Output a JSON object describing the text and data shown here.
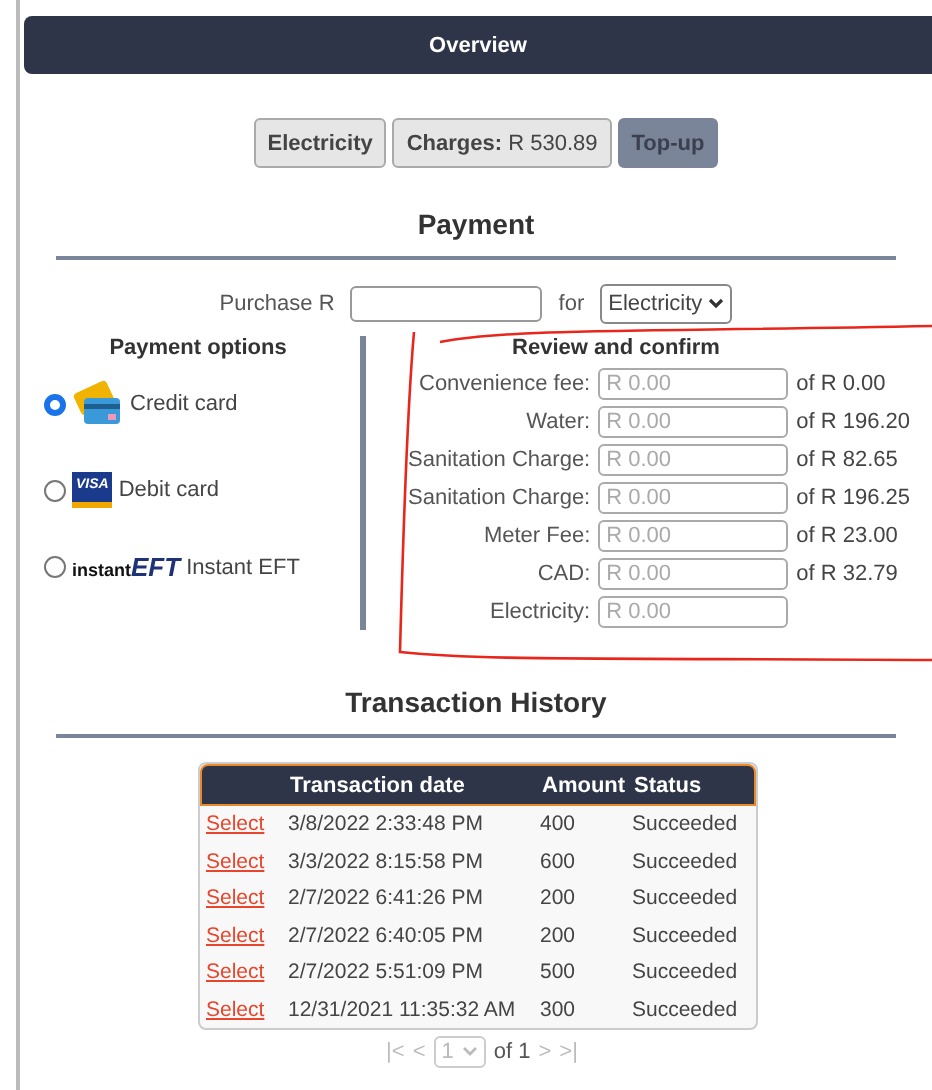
{
  "header": {
    "title": "Overview"
  },
  "toolbar": [
    {
      "kind": "plain",
      "label": "Electricity",
      "selected": false
    },
    {
      "kind": "value",
      "label": "Charges:",
      "value": "R 530.89",
      "selected": false
    },
    {
      "kind": "plain",
      "label": "Top-up",
      "selected": true
    }
  ],
  "payment": {
    "title": "Payment",
    "purchase_label": "Purchase R",
    "for_label": "for",
    "service": "Electricity"
  },
  "payment_options": {
    "title": "Payment options",
    "options": [
      {
        "kind": "credit",
        "label": "Credit card",
        "selected": true
      },
      {
        "kind": "visa",
        "label": "Debit card",
        "logo_text": "VISA",
        "selected": false
      },
      {
        "kind": "eft",
        "label": "Instant EFT",
        "logo_text": "instant",
        "logo_emphasis": "EFT",
        "selected": false
      }
    ]
  },
  "review": {
    "title": "Review and confirm",
    "rows": [
      {
        "label": "Convenience fee:",
        "placeholder": "R 0.00",
        "total": "of R 0.00"
      },
      {
        "label": "Water:",
        "placeholder": "R 0.00",
        "total": "of R 196.20"
      },
      {
        "label": "Sanitation Charge:",
        "placeholder": "R 0.00",
        "total": "of R 82.65"
      },
      {
        "label": "Sanitation Charge:",
        "placeholder": "R 0.00",
        "total": "of R 196.25"
      },
      {
        "label": "Meter Fee:",
        "placeholder": "R 0.00",
        "total": "of R 23.00"
      },
      {
        "label": "CAD:",
        "placeholder": "R 0.00",
        "total": "of R 32.79"
      },
      {
        "label": "Electricity:",
        "placeholder": "R 0.00"
      }
    ]
  },
  "history": {
    "title": "Transaction History",
    "columns": [
      "Transaction date",
      "Amount",
      "Status"
    ],
    "rows": [
      {
        "link": "Select",
        "date": "3/8/2022 2:33:48 PM",
        "amount": "400",
        "status": "Succeeded"
      },
      {
        "link": "Select",
        "date": "3/3/2022 8:15:58 PM",
        "amount": "600",
        "status": "Succeeded"
      },
      {
        "link": "Select",
        "date": "2/7/2022 6:41:26 PM",
        "amount": "200",
        "status": "Succeeded"
      },
      {
        "link": "Select",
        "date": "2/7/2022 6:40:05 PM",
        "amount": "200",
        "status": "Succeeded"
      },
      {
        "link": "Select",
        "date": "2/7/2022 5:51:09 PM",
        "amount": "500",
        "status": "Succeeded"
      },
      {
        "link": "Select",
        "date": "12/31/2021 11:35:32 AM",
        "amount": "300",
        "status": "Succeeded"
      }
    ],
    "pager": {
      "first": "|<",
      "prev": "<",
      "page": "1",
      "of": "of 1",
      "next": ">",
      "last": ">|",
      "disabled": true
    }
  }
}
